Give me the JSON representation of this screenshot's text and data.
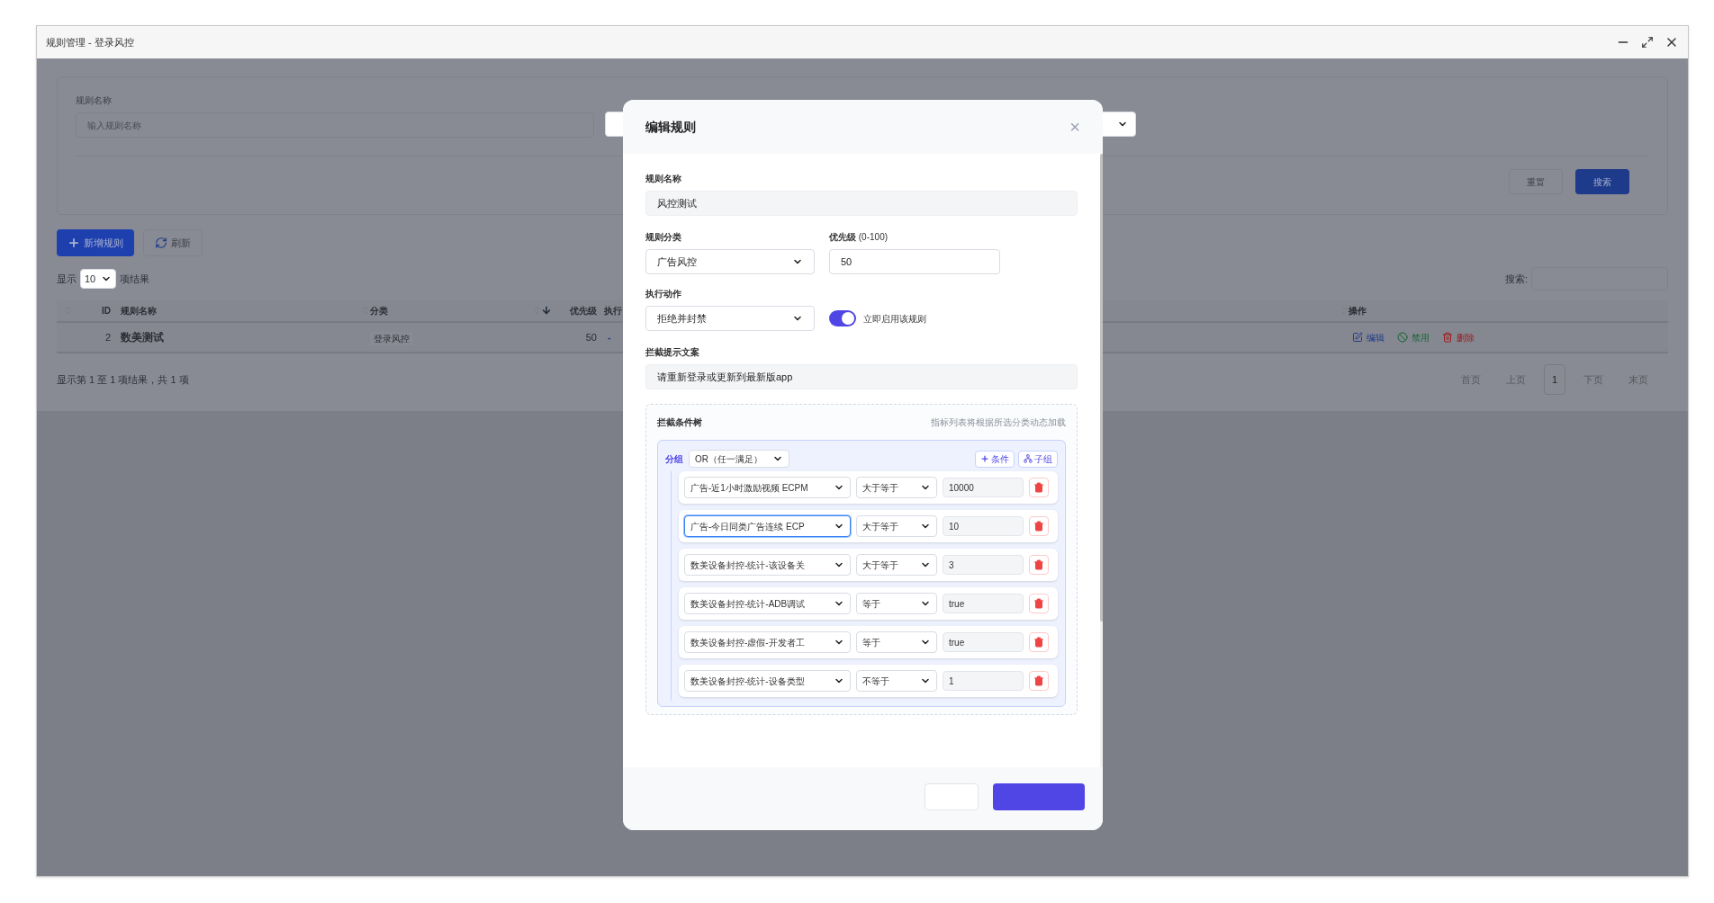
{
  "window": {
    "title": "规则管理 - 登录风控"
  },
  "filter_form": {
    "fields": [
      {
        "label": "规则名称",
        "placeholder": "输入规则名称"
      }
    ],
    "buttons": [
      {
        "label": "重置",
        "kind": "secondary"
      },
      {
        "label": "搜索",
        "kind": "primary"
      }
    ]
  },
  "toolbar": [
    {
      "label": "新增规则",
      "kind": "add"
    },
    {
      "label": "刷新",
      "kind": "refresh"
    }
  ],
  "page_length": {
    "prefix": "显示",
    "value": "10",
    "suffix": "项结果"
  },
  "search": {
    "label": "搜索:"
  },
  "table": {
    "columns": [
      {
        "label": "ID",
        "sorted": false
      },
      {
        "label": "规则名称",
        "sorted": false
      },
      {
        "label": "分类",
        "sorted": false
      },
      {
        "label": "优先级",
        "sorted": true
      },
      {
        "label": "执行",
        "sorted": false
      },
      {
        "label": "操作"
      }
    ],
    "rows": [
      {
        "id": "2",
        "name": "数美测试",
        "category": "登录风控",
        "priority": "50",
        "action": "-",
        "ops": [
          {
            "label": "编辑",
            "kind": "edit"
          },
          {
            "label": "禁用",
            "kind": "disable"
          },
          {
            "label": "删除",
            "kind": "delete"
          }
        ]
      }
    ]
  },
  "info": "显示第 1 至 1 项结果，共 1 项",
  "pagination": [
    {
      "label": "首页",
      "selected": false
    },
    {
      "label": "上页",
      "selected": false
    },
    {
      "label": "1",
      "selected": true
    },
    {
      "label": "下页",
      "selected": false
    },
    {
      "label": "末页",
      "selected": false
    }
  ],
  "modal": {
    "title": "编辑规则",
    "close": "×",
    "name": {
      "label": "规则名称",
      "value": "风控测试"
    },
    "category": {
      "label": "规则分类",
      "value": "广告风控"
    },
    "priority": {
      "label": "优先级",
      "hint": "(0-100)",
      "value": "50"
    },
    "action": {
      "label": "执行动作",
      "value": "拒绝并封禁"
    },
    "enabled": {
      "label": "立即启用该规则",
      "on": true
    },
    "message": {
      "label": "拦截提示文案",
      "value": "请重新登录或更新到最新版app"
    },
    "tree": {
      "title": "拦截条件树",
      "hint": "指标列表将根据所选分类动态加载",
      "group": {
        "label": "分组",
        "logic": "OR（任一满足）",
        "buttons": [
          {
            "label": "条件",
            "kind": "add"
          },
          {
            "label": "子组",
            "kind": "subgroup"
          }
        ],
        "conditions": [
          {
            "metric": "广告-近1小时激励视频 ECPM",
            "operator": "大于等于",
            "value": "10000",
            "focused": false
          },
          {
            "metric": "广告-今日同类广告连续 ECP",
            "operator": "大于等于",
            "value": "10",
            "focused": true
          },
          {
            "metric": "数美设备封控-统计-该设备关",
            "operator": "大于等于",
            "value": "3",
            "focused": false
          },
          {
            "metric": "数美设备封控-统计-ADB调试",
            "operator": "等于",
            "value": "true",
            "focused": false
          },
          {
            "metric": "数美设备封控-虚假-开发者工",
            "operator": "等于",
            "value": "true",
            "focused": false
          },
          {
            "metric": "数美设备封控-统计-设备类型",
            "operator": "不等于",
            "value": "1",
            "focused": false
          }
        ]
      }
    },
    "footer_buttons": [
      {
        "kind": "secondary"
      },
      {
        "kind": "primary"
      }
    ]
  }
}
